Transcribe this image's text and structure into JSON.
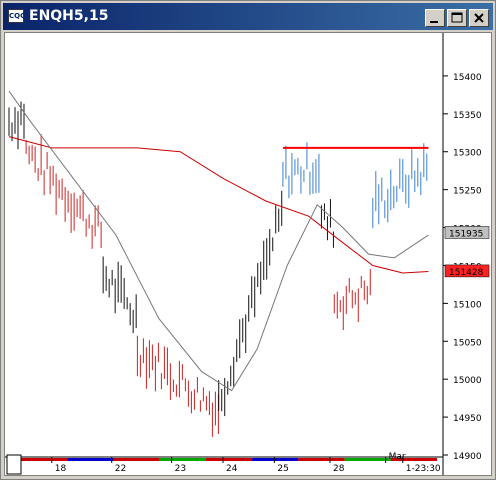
{
  "window": {
    "title": "ENQH5,15",
    "icon": "cqg-app-icon",
    "buttons": [
      "minimize-icon",
      "maximize-icon",
      "close-icon"
    ]
  },
  "chart_data": {
    "type": "bar",
    "instrument": "ENQH5,15",
    "ylim": [
      14900,
      15450
    ],
    "y_ticks": [
      "15400",
      "15350",
      "15300",
      "15250",
      "15200",
      "15150",
      "15100",
      "15050",
      "15000",
      "14950",
      "14900"
    ],
    "x_ticks": [
      "18",
      "22",
      "23",
      "24",
      "25",
      "28",
      "Mar",
      "1-23:30"
    ],
    "price_tags": [
      {
        "label": "151935",
        "value": 15193.5,
        "color": "#c0c0c0"
      },
      {
        "label": "151428",
        "value": 15142.8,
        "color": "#ff2222"
      }
    ],
    "resistance_line": {
      "value": 15305,
      "color": "#ff0000",
      "x_range": [
        0.64,
        0.98
      ]
    },
    "colors": {
      "up": "#3a7fd0",
      "down": "#cc2222",
      "neutral": "#111111",
      "ma_slow": "#cc0000",
      "ma_fast": "#777777"
    },
    "segments": [
      {
        "color": "neutral",
        "start": 0.0,
        "end": 0.04,
        "price": [
          15340,
          15350
        ]
      },
      {
        "color": "down",
        "start": 0.04,
        "end": 0.22,
        "price": [
          15300,
          15190
        ]
      },
      {
        "color": "neutral",
        "start": 0.22,
        "end": 0.3,
        "price": [
          15140,
          15080
        ]
      },
      {
        "color": "down",
        "start": 0.3,
        "end": 0.49,
        "price": [
          15040,
          14960
        ]
      },
      {
        "color": "neutral",
        "start": 0.49,
        "end": 0.64,
        "price": [
          14970,
          15220
        ]
      },
      {
        "color": "up",
        "start": 0.64,
        "end": 0.73,
        "price": [
          15270,
          15280
        ]
      },
      {
        "color": "neutral",
        "start": 0.73,
        "end": 0.76,
        "price": [
          15210,
          15200
        ]
      },
      {
        "color": "down",
        "start": 0.76,
        "end": 0.85,
        "price": [
          15100,
          15120
        ]
      },
      {
        "color": "up",
        "start": 0.85,
        "end": 0.98,
        "price": [
          15230,
          15280
        ]
      }
    ],
    "ma_slow": [
      [
        0.0,
        15320
      ],
      [
        0.1,
        15305
      ],
      [
        0.2,
        15305
      ],
      [
        0.3,
        15305
      ],
      [
        0.4,
        15300
      ],
      [
        0.5,
        15265
      ],
      [
        0.6,
        15235
      ],
      [
        0.7,
        15215
      ],
      [
        0.78,
        15180
      ],
      [
        0.85,
        15150
      ],
      [
        0.92,
        15140
      ],
      [
        0.98,
        15142
      ]
    ],
    "ma_fast": [
      [
        0.0,
        15380
      ],
      [
        0.05,
        15340
      ],
      [
        0.15,
        15265
      ],
      [
        0.25,
        15190
      ],
      [
        0.35,
        15080
      ],
      [
        0.45,
        15010
      ],
      [
        0.52,
        14985
      ],
      [
        0.58,
        15040
      ],
      [
        0.65,
        15150
      ],
      [
        0.72,
        15230
      ],
      [
        0.78,
        15200
      ],
      [
        0.84,
        15165
      ],
      [
        0.9,
        15160
      ],
      [
        0.98,
        15190
      ]
    ],
    "legend": "none",
    "grid": false
  }
}
